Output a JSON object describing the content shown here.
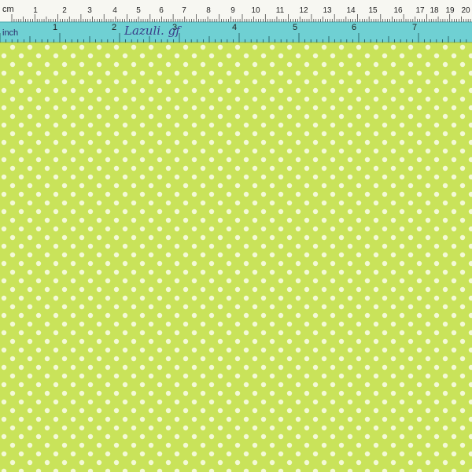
{
  "ruler": {
    "cm_unit": "cm",
    "inch_unit": "inch",
    "cm_labels": [
      "1",
      "2",
      "3",
      "4",
      "5",
      "6",
      "7",
      "8",
      "9",
      "10",
      "11",
      "12",
      "13",
      "14",
      "15",
      "16",
      "17",
      "18",
      "19",
      "20"
    ],
    "inch_labels": [
      "1",
      "2",
      "3",
      "4",
      "5",
      "6",
      "7"
    ],
    "handwritten_note": "Lazuli. gf"
  },
  "fabric": {
    "pattern": "polka-dot",
    "colors": {
      "background": "#c9e35a",
      "dot": "#f3f9d6",
      "ruler_white": "#f7f7f2",
      "ruler_teal": "#6fd0d3",
      "ink": "#222222",
      "handwriting": "#3a3f8a"
    }
  }
}
